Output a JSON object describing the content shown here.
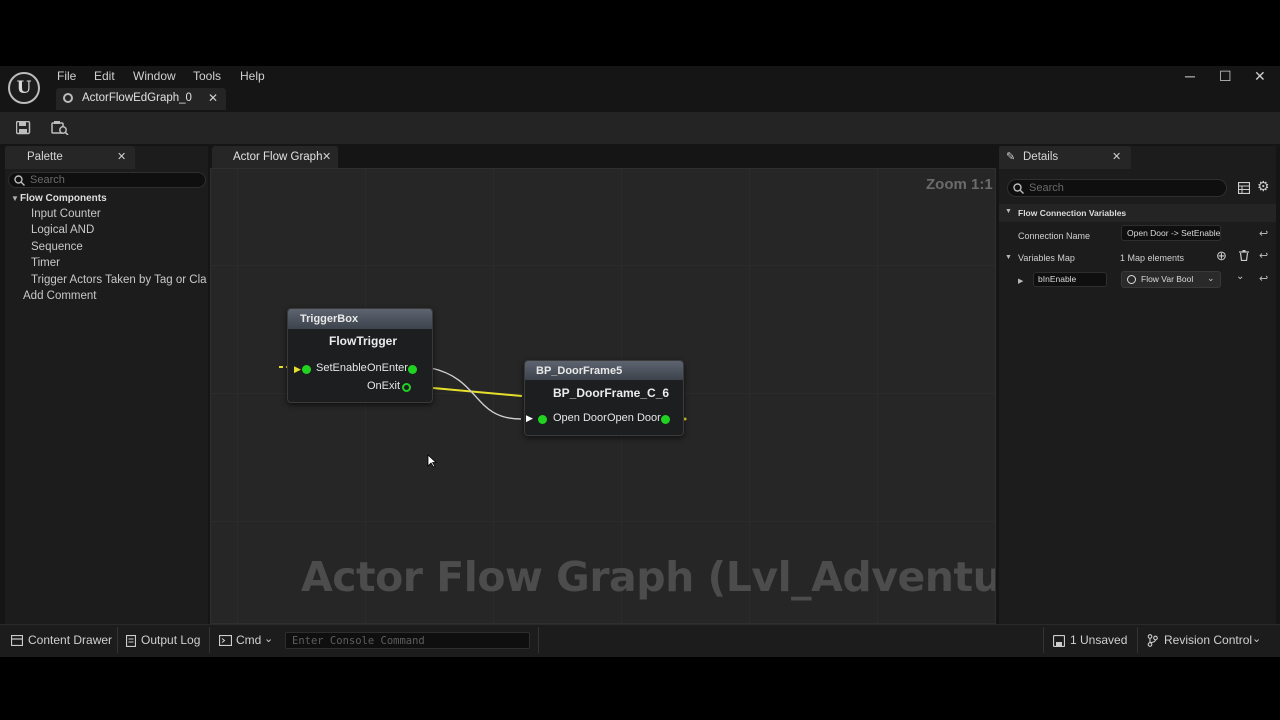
{
  "window": {
    "menu": [
      "File",
      "Edit",
      "Window",
      "Tools",
      "Help"
    ],
    "document_tab": "ActorFlowEdGraph_0",
    "controls": {
      "minimize": "─",
      "maximize": "☐",
      "close": "✕"
    }
  },
  "palette": {
    "tab_label": "Palette",
    "search_placeholder": "Search",
    "category": "Flow Components",
    "items": [
      "Input Counter",
      "Logical AND",
      "Sequence",
      "Timer",
      "Trigger Actors Taken by Tag or Cla"
    ],
    "add_comment": "Add Comment"
  },
  "graph": {
    "tab_label": "Actor Flow Graph",
    "zoom": "Zoom 1:1",
    "watermark": "Actor Flow Graph (Lvl_Adventure)",
    "nodes": [
      {
        "header": "TriggerBox",
        "title": "FlowTrigger",
        "inputs": [
          "SetEnable"
        ],
        "outputs": [
          "OnEnter",
          "OnExit"
        ]
      },
      {
        "header": "BP_DoorFrame5",
        "title": "BP_DoorFrame_C_6",
        "inputs": [
          "Open Door"
        ],
        "outputs": [
          "Open Door"
        ]
      }
    ]
  },
  "details": {
    "tab_label": "Details",
    "search_placeholder": "Search",
    "section": "Flow Connection Variables",
    "connection_name_label": "Connection Name",
    "connection_name_value": "Open Door -> SetEnable",
    "variables_map_label": "Variables Map",
    "variables_map_value": "1 Map elements",
    "map_key": "bInEnable",
    "map_value": "Flow Var Bool"
  },
  "statusbar": {
    "content_drawer": "Content Drawer",
    "output_log": "Output Log",
    "cmd": "Cmd",
    "console_placeholder": "Enter Console Command",
    "unsaved": "1 Unsaved",
    "revision_control": "Revision Control"
  },
  "colors": {
    "exec_pin": "#21d321",
    "wire_yellow": "#e6e02a",
    "wire_white": "#d0d0d0"
  }
}
